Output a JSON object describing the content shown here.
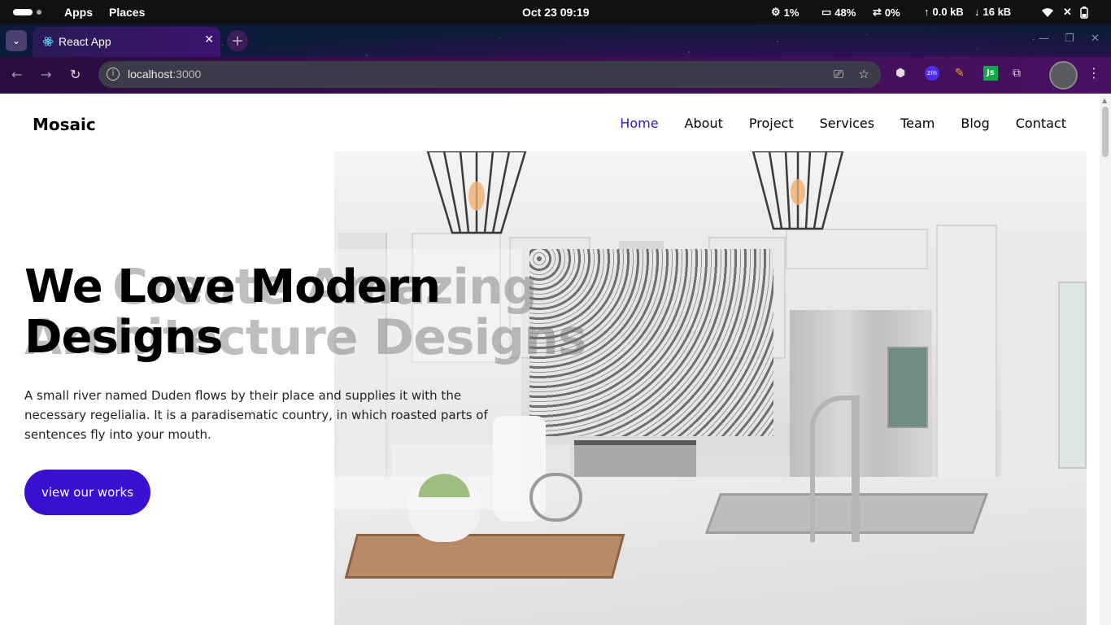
{
  "system_bar": {
    "apps": "Apps",
    "places": "Places",
    "clock": "Oct 23  09:19",
    "cpu": "1%",
    "memory": "48%",
    "swap": "0%",
    "upload": "0.0 kB",
    "download": "16 kB"
  },
  "browser": {
    "tab_title": "React App",
    "url_host": "localhost",
    "url_port": ":3000",
    "ext_zoom": "zm",
    "ext_js": "Js"
  },
  "site": {
    "brand": "Mosaic",
    "nav": [
      {
        "label": "Home",
        "active": true
      },
      {
        "label": "About"
      },
      {
        "label": "Project"
      },
      {
        "label": "Services"
      },
      {
        "label": "Team"
      },
      {
        "label": "Blog"
      },
      {
        "label": "Contact"
      }
    ],
    "ghost_line1": "Create Amazing",
    "ghost_line2": "Architecture Designs",
    "headline_line1": "We Love Modern",
    "headline_line2": "Designs",
    "description": "A small river named Duden flows by their place and supplies it with the necessary regelialia. It is a paradisematic country, in which roasted parts of sentences fly into your mouth.",
    "cta": "view our works"
  },
  "colors": {
    "accent": "#3a13c5",
    "cta_bg": "#3a0fd0"
  }
}
